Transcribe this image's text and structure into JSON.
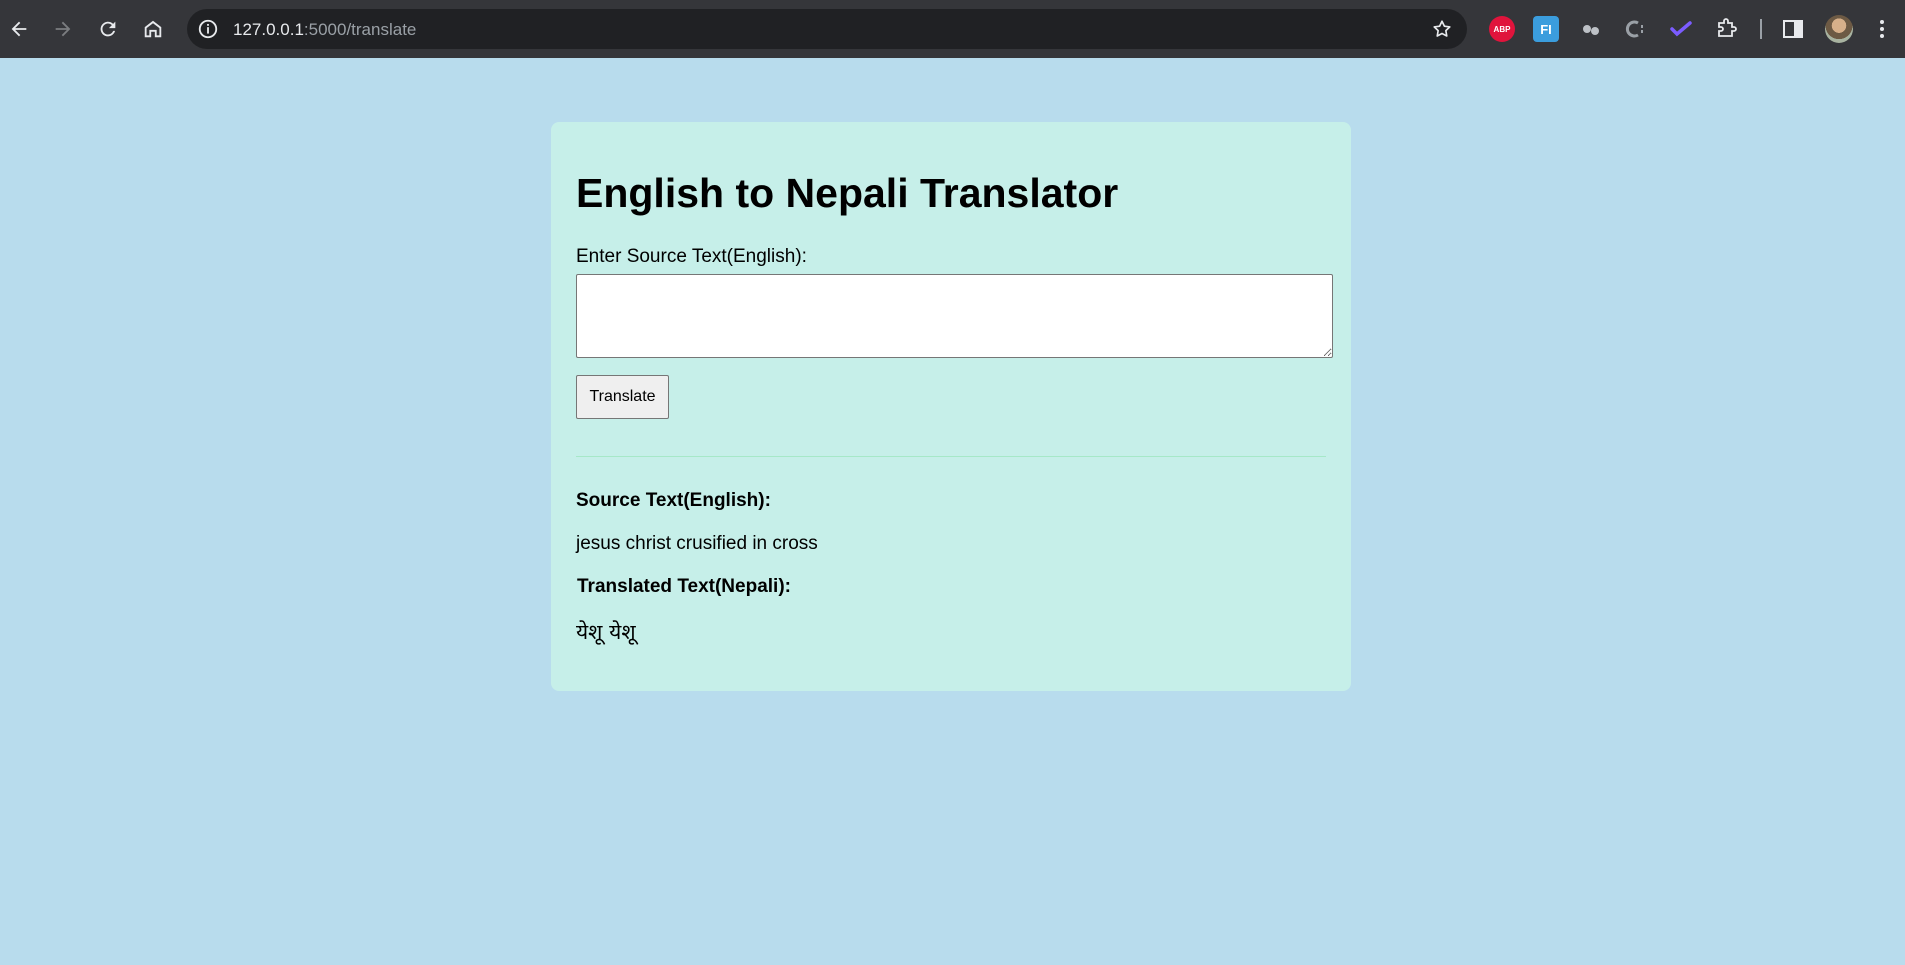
{
  "browser": {
    "url_host": "127.0.0.1",
    "url_path": ":5000/translate",
    "extensions": {
      "abp_label": "ABP",
      "fi_label": "FI"
    },
    "colors": {
      "toolbar": "#35363a",
      "omnibox": "#202124"
    }
  },
  "page": {
    "background": "#b8dced",
    "card_background": "#c6efe9",
    "title": "English to Nepali Translator",
    "input_label": "Enter Source Text(English):",
    "input_value": "",
    "translate_button": "Translate",
    "source_heading": "Source Text(English):",
    "source_text": "jesus christ crusified in cross",
    "translated_heading": "Translated Text(Nepali):",
    "translated_text": "येशू येशू"
  }
}
